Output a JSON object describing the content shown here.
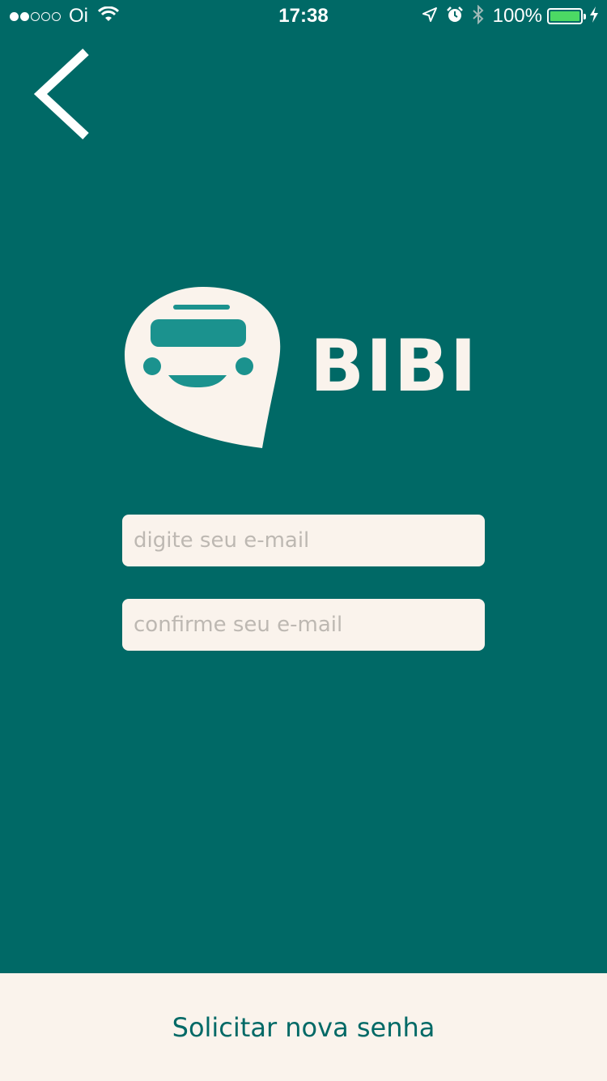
{
  "status_bar": {
    "carrier": "Oi",
    "time": "17:38",
    "battery": "100%",
    "signal_bars_filled": 2,
    "signal_bars_total": 5,
    "icons": [
      "wifi-icon",
      "location-arrow-icon",
      "alarm-icon",
      "bluetooth-icon",
      "battery-icon",
      "charging-bolt-icon"
    ]
  },
  "nav": {
    "back_icon": "chevron-left-icon"
  },
  "brand": {
    "name": "BIBI",
    "logo_icon": "bus-speech-bubble-icon"
  },
  "form": {
    "email_placeholder": "digite seu e-mail",
    "email_value": "",
    "confirm_placeholder": "confirme seu e-mail",
    "confirm_value": ""
  },
  "actions": {
    "submit_label": "Solicitar nova senha"
  },
  "colors": {
    "background": "#006966",
    "cream": "#faf3ec",
    "accent": "#1b928e",
    "battery": "#4cd964"
  }
}
